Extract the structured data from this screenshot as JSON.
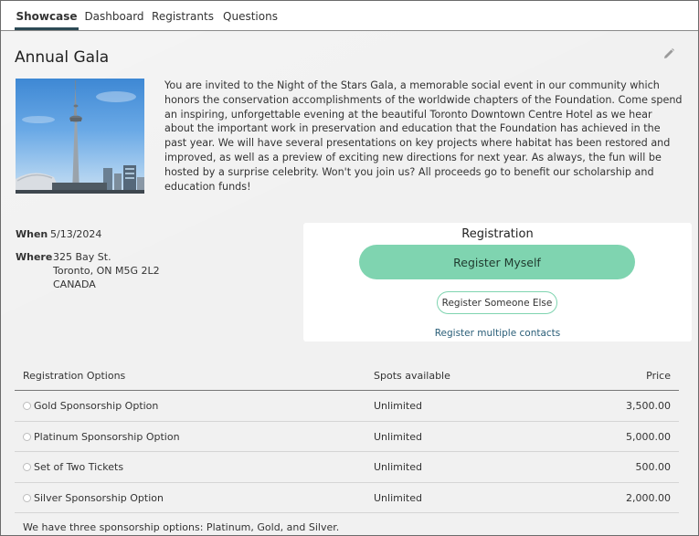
{
  "tabs": [
    {
      "label": "Showcase",
      "active": true
    },
    {
      "label": "Dashboard",
      "active": false
    },
    {
      "label": "Registrants",
      "active": false
    },
    {
      "label": "Questions",
      "active": false
    }
  ],
  "event": {
    "title": "Annual Gala",
    "description": "You are invited to the Night of the Stars Gala, a memorable social event in our community which honors the conservation accomplishments of the worldwide chapters of the Foundation. Come spend an inspiring, unforgettable evening at the beautiful Toronto Downtown Centre Hotel as we hear about the important work in preservation and education that the Foundation has achieved in the past year. We will have several presentations on key projects where habitat has been restored and improved, as well as a preview of exciting new directions for next year. As always, the fun will be hosted by a surprise celebrity. Won't you join us? All proceeds go to benefit our scholarship and education funds!",
    "when_label": "When",
    "when_value": "5/13/2024",
    "where_label": "Where",
    "address_line1": "325 Bay St.",
    "address_line2": "Toronto, ON M5G 2L2",
    "address_line3": "CANADA"
  },
  "registration": {
    "title": "Registration",
    "register_myself": "Register Myself",
    "register_someone_else": "Register Someone Else",
    "register_multiple": "Register multiple contacts"
  },
  "options": {
    "headers": {
      "name": "Registration Options",
      "spots": "Spots available",
      "price": "Price"
    },
    "rows": [
      {
        "name": "Gold Sponsorship Option",
        "spots": "Unlimited",
        "price": "3,500.00"
      },
      {
        "name": "Platinum Sponsorship Option",
        "spots": "Unlimited",
        "price": "5,000.00"
      },
      {
        "name": "Set of Two Tickets",
        "spots": "Unlimited",
        "price": "500.00"
      },
      {
        "name": "Silver Sponsorship Option",
        "spots": "Unlimited",
        "price": "2,000.00"
      }
    ]
  },
  "footer_note": "We have three sponsorship options: Platinum, Gold, and Silver.",
  "icons": {
    "edit": "pencil-icon",
    "photo": "event-photo"
  },
  "colors": {
    "accent": "#7fd4b0",
    "tab_active_underline": "#2c4a55",
    "link": "#2a5e78"
  }
}
